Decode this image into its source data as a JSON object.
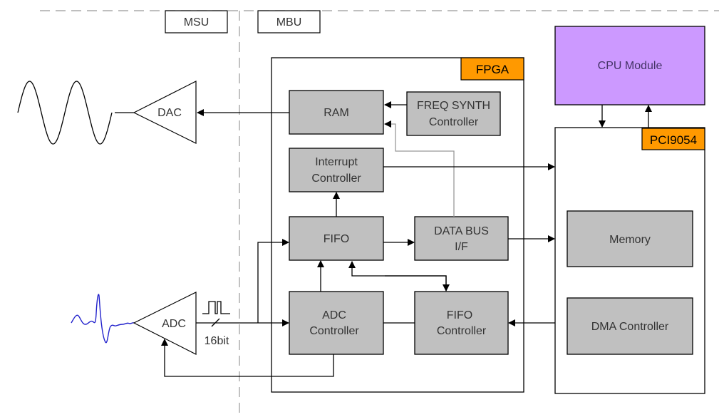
{
  "labels": {
    "msu": "MSU",
    "mbu": "MBU",
    "fpga": "FPGA",
    "pci9054": "PCI9054",
    "cpu_module": "CPU Module",
    "dac": "DAC",
    "adc": "ADC",
    "bit_width": "16bit"
  },
  "blocks": {
    "ram": [
      "RAM"
    ],
    "freq_synth": [
      "FREQ SYNTH",
      "Controller"
    ],
    "interrupt": [
      "Interrupt",
      "Controller"
    ],
    "fifo": [
      "FIFO"
    ],
    "data_bus": [
      "DATA BUS",
      "I/F"
    ],
    "adc_controller": [
      "ADC",
      "Controller"
    ],
    "fifo_controller": [
      "FIFO",
      "Controller"
    ],
    "memory": [
      "Memory"
    ],
    "dma": [
      "DMA Controller"
    ]
  },
  "colors": {
    "fpga_label": "#ff9900",
    "pci_label": "#ff9900",
    "cpu_module": "#cc99ff",
    "block": "#c0c0c0",
    "input_signal": "#2222cc"
  }
}
